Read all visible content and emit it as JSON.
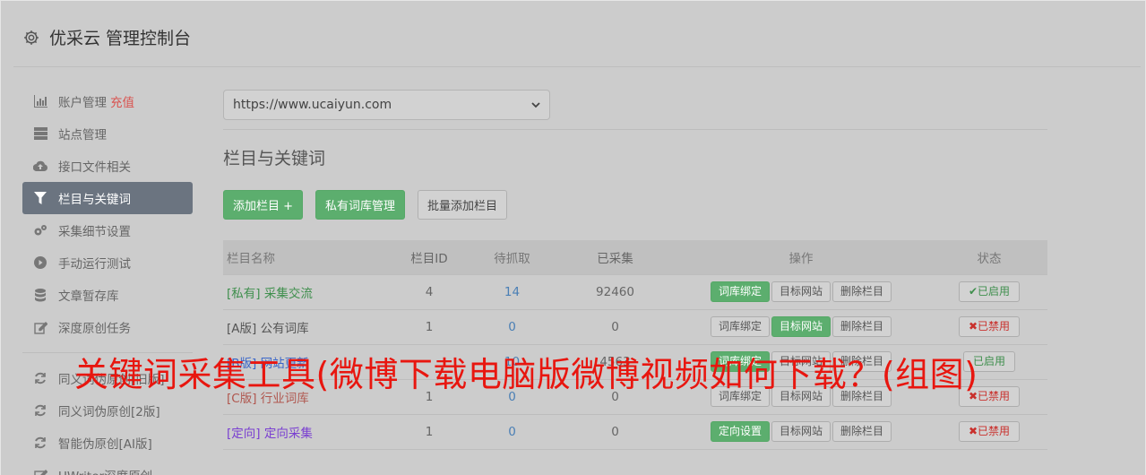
{
  "app": {
    "title": "优采云 管理控制台",
    "icon": "gear-icon"
  },
  "sidebar": {
    "items": [
      {
        "label": "账户管理",
        "extra": "充值",
        "icon": "bar-chart-icon",
        "active": false
      },
      {
        "label": "站点管理",
        "icon": "server-icon",
        "active": false
      },
      {
        "label": "接口文件相关",
        "icon": "cloud-upload-icon",
        "active": false
      },
      {
        "label": "栏目与关键词",
        "icon": "filter-icon",
        "active": true
      },
      {
        "label": "采集细节设置",
        "icon": "cogs-icon",
        "active": false
      },
      {
        "label": "手动运行测试",
        "icon": "play-circle-icon",
        "active": false
      },
      {
        "label": "文章暂存库",
        "icon": "database-icon",
        "active": false
      },
      {
        "label": "深度原创任务",
        "icon": "edit-icon",
        "active": false
      }
    ],
    "items2": [
      {
        "label": "同义词伪原创[旧版]",
        "icon": "refresh-icon"
      },
      {
        "label": "同义词伪原创[2版]",
        "icon": "refresh-icon"
      },
      {
        "label": "智能伪原创[AI版]",
        "icon": "refresh-icon"
      },
      {
        "label": "UWriter深度原创",
        "icon": "edit-icon"
      }
    ]
  },
  "main": {
    "site_select": {
      "value": "https://www.ucaiyun.com"
    },
    "section_title": "栏目与关键词",
    "buttons": {
      "add_column": "添加栏目 +",
      "private_lib": "私有词库管理",
      "bulk_add": "批量添加栏目"
    },
    "table": {
      "headers": [
        "栏目名称",
        "栏目ID",
        "待抓取",
        "已采集",
        "操作",
        "状态"
      ],
      "rows": [
        {
          "tag": "[私有]",
          "name": "采集交流",
          "id": "4",
          "pending": "14",
          "done": "92460",
          "op1": "词库绑定",
          "op2": "目标网站",
          "op3": "删除栏目",
          "status": "✔已启用",
          "tagcls": "tag-private",
          "op1g": true,
          "op2g": false,
          "on": true
        },
        {
          "tag": "[A版]",
          "name": "公有词库",
          "id": "1",
          "pending": "0",
          "done": "0",
          "op1": "词库绑定",
          "op2": "目标网站",
          "op3": "删除栏目",
          "status": "✖已禁用",
          "tagcls": "tag-a",
          "op1g": false,
          "op2g": true,
          "on": false
        },
        {
          "tag": "[B版]",
          "name": "网站更新",
          "id": "",
          "pending": "10",
          "done": "4563",
          "op1": "词库绑定",
          "op2": "目标网站",
          "op3": "删除栏目",
          "status": "已启用",
          "tagcls": "tag-site",
          "op1g": true,
          "op2g": false,
          "on": true
        },
        {
          "tag": "[C版]",
          "name": "行业词库",
          "id": "1",
          "pending": "0",
          "done": "0",
          "op1": "词库绑定",
          "op2": "目标网站",
          "op3": "删除栏目",
          "status": "✖已禁用",
          "tagcls": "tag-c",
          "op1g": false,
          "op2g": false,
          "on": false
        },
        {
          "tag": "[定向]",
          "name": "定向采集",
          "id": "1",
          "pending": "0",
          "done": "0",
          "op1": "定向设置",
          "op2": "目标网站",
          "op3": "删除栏目",
          "status": "✖已禁用",
          "tagcls": "tag-dir",
          "op1g": true,
          "op2g": false,
          "on": false
        }
      ]
    }
  },
  "overlay_text": "关键词采集工具(微博下载电脑版微博视频如何下载？(组图)"
}
